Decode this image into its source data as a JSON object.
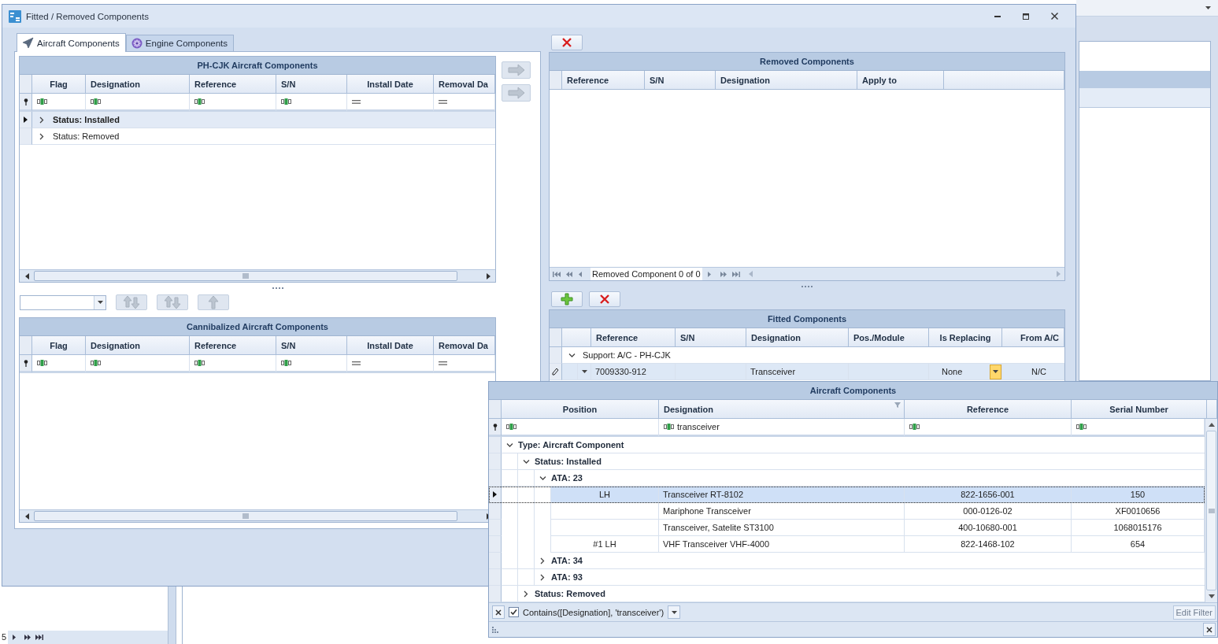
{
  "window": {
    "title": "Fitted / Removed Components"
  },
  "tabs": [
    {
      "label": "Aircraft Components",
      "kind": "aircraft",
      "selected": true
    },
    {
      "label": "Engine Components",
      "kind": "engine",
      "selected": false
    }
  ],
  "installed_grid": {
    "title": "PH-CJK Aircraft Components",
    "columns": [
      {
        "label": "Flag",
        "kind": "text"
      },
      {
        "label": "Designation",
        "kind": "text"
      },
      {
        "label": "Reference",
        "kind": "text"
      },
      {
        "label": "S/N",
        "kind": "text"
      },
      {
        "label": "Install Date",
        "kind": "date"
      },
      {
        "label": "Removal Da",
        "kind": "date"
      }
    ],
    "rows": [
      {
        "kind": "group",
        "label": "Status: Installed",
        "expanded": false,
        "selected": true
      },
      {
        "kind": "group",
        "label": "Status: Removed",
        "expanded": false,
        "selected": false
      }
    ]
  },
  "transfer_buttons": [
    {
      "kind": "move-right",
      "disabled": true
    },
    {
      "kind": "move-right",
      "disabled": true
    }
  ],
  "order_toolbar": [
    {
      "kind": "combo"
    },
    {
      "kind": "up-down",
      "disabled": true
    },
    {
      "kind": "up-down",
      "disabled": true
    },
    {
      "kind": "up",
      "disabled": true
    }
  ],
  "cannibalized_grid": {
    "title": "Cannibalized Aircraft Components",
    "columns": [
      {
        "label": "Flag",
        "kind": "text"
      },
      {
        "label": "Designation",
        "kind": "text"
      },
      {
        "label": "Reference",
        "kind": "text"
      },
      {
        "label": "S/N",
        "kind": "text"
      },
      {
        "label": "Install Date",
        "kind": "date"
      },
      {
        "label": "Removal Da",
        "kind": "date"
      }
    ]
  },
  "removed_toolbar": [
    {
      "kind": "delete"
    }
  ],
  "removed_grid": {
    "title": "Removed Components",
    "columns": [
      {
        "label": "Reference"
      },
      {
        "label": "S/N"
      },
      {
        "label": "Designation"
      },
      {
        "label": "Apply to"
      }
    ],
    "navigator": "Removed Component 0 of 0"
  },
  "fitted_toolbar": [
    {
      "kind": "add"
    },
    {
      "kind": "delete"
    }
  ],
  "fitted_grid": {
    "title": "Fitted Components",
    "columns": [
      {
        "label": "Reference"
      },
      {
        "label": "S/N"
      },
      {
        "label": "Designation"
      },
      {
        "label": "Pos./Module"
      },
      {
        "label": "Is Replacing"
      },
      {
        "label": "From A/C"
      }
    ],
    "rows": [
      {
        "kind": "group",
        "label": "Support: A/C - PH-CJK",
        "expanded": true,
        "selected": false,
        "children": [
          {
            "kind": "row",
            "reference": "7009330-912",
            "designation": "Transceiver",
            "is_replacing": "None",
            "from_ac": "N/C",
            "selected": true,
            "editing": true
          }
        ]
      }
    ]
  },
  "lookup": {
    "title": "Aircraft Components",
    "columns": [
      {
        "label": "Position",
        "kind": "text"
      },
      {
        "label": "Designation",
        "kind": "text",
        "filter_value": "transceiver",
        "filtered": true
      },
      {
        "label": "Reference",
        "kind": "text"
      },
      {
        "label": "Serial Number",
        "kind": "text"
      }
    ],
    "tree": [
      {
        "kind": "group",
        "label": "Type: Aircraft Component",
        "expanded": true,
        "selected": false,
        "children": [
          {
            "kind": "group",
            "label": "Status: Installed",
            "expanded": true,
            "selected": false,
            "children": [
              {
                "kind": "group",
                "label": "ATA: 23",
                "expanded": true,
                "selected": false,
                "children": [
                  {
                    "kind": "row",
                    "position": "LH",
                    "designation": "Transceiver RT-8102",
                    "reference": "822-1656-001",
                    "serial": "150",
                    "selected": true
                  },
                  {
                    "kind": "row",
                    "designation": "Mariphone Transceiver",
                    "reference": "000-0126-02",
                    "serial": "XF0010656",
                    "selected": false
                  },
                  {
                    "kind": "row",
                    "designation": "Transceiver, Satelite ST3100",
                    "reference": "400-10680-001",
                    "serial": "1068015176",
                    "selected": false
                  },
                  {
                    "kind": "row",
                    "position": "#1 LH",
                    "designation": "VHF Transceiver VHF-4000",
                    "reference": "822-1468-102",
                    "serial": "654",
                    "selected": false
                  }
                ]
              },
              {
                "kind": "group",
                "label": "ATA: 34",
                "expanded": false,
                "selected": false
              },
              {
                "kind": "group",
                "label": "ATA: 93",
                "expanded": false,
                "selected": false
              }
            ]
          },
          {
            "kind": "group",
            "label": "Status: Removed",
            "expanded": false,
            "selected": false
          }
        ]
      }
    ],
    "filter_panel": {
      "enabled": true,
      "expression": "Contains([Designation], 'transceiver')",
      "edit_button": "Edit Filter"
    }
  },
  "background": {
    "pager_text": "5"
  }
}
